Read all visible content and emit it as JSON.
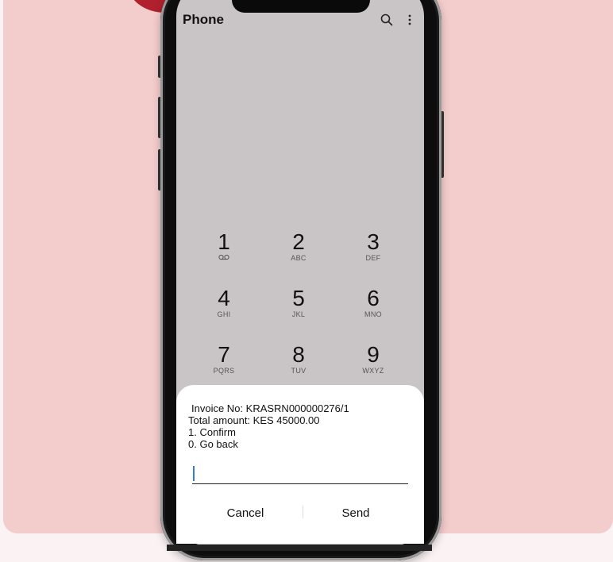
{
  "app": {
    "title": "Phone"
  },
  "toolbar": {
    "search_icon": "search-icon",
    "more_icon": "more-vert-icon"
  },
  "dialpad": {
    "keys": [
      {
        "digit": "1",
        "letters": ""
      },
      {
        "digit": "2",
        "letters": "ABC"
      },
      {
        "digit": "3",
        "letters": "DEF"
      },
      {
        "digit": "4",
        "letters": "GHI"
      },
      {
        "digit": "5",
        "letters": "JKL"
      },
      {
        "digit": "6",
        "letters": "MNO"
      },
      {
        "digit": "7",
        "letters": "PQRS"
      },
      {
        "digit": "8",
        "letters": "TUV"
      },
      {
        "digit": "9",
        "letters": "WXYZ"
      }
    ]
  },
  "dialog": {
    "lines": [
      "Invoice No: KRASRN000000276/1",
      "Total amount: KES 45000.00",
      "1. Confirm",
      "0. Go back"
    ],
    "input_value": "",
    "cancel_label": "Cancel",
    "send_label": "Send"
  },
  "colors": {
    "background_card": "#f3cccc",
    "badge": "#b0202e",
    "screen": "#c9c5c6",
    "cursor": "#3a7bd5"
  }
}
